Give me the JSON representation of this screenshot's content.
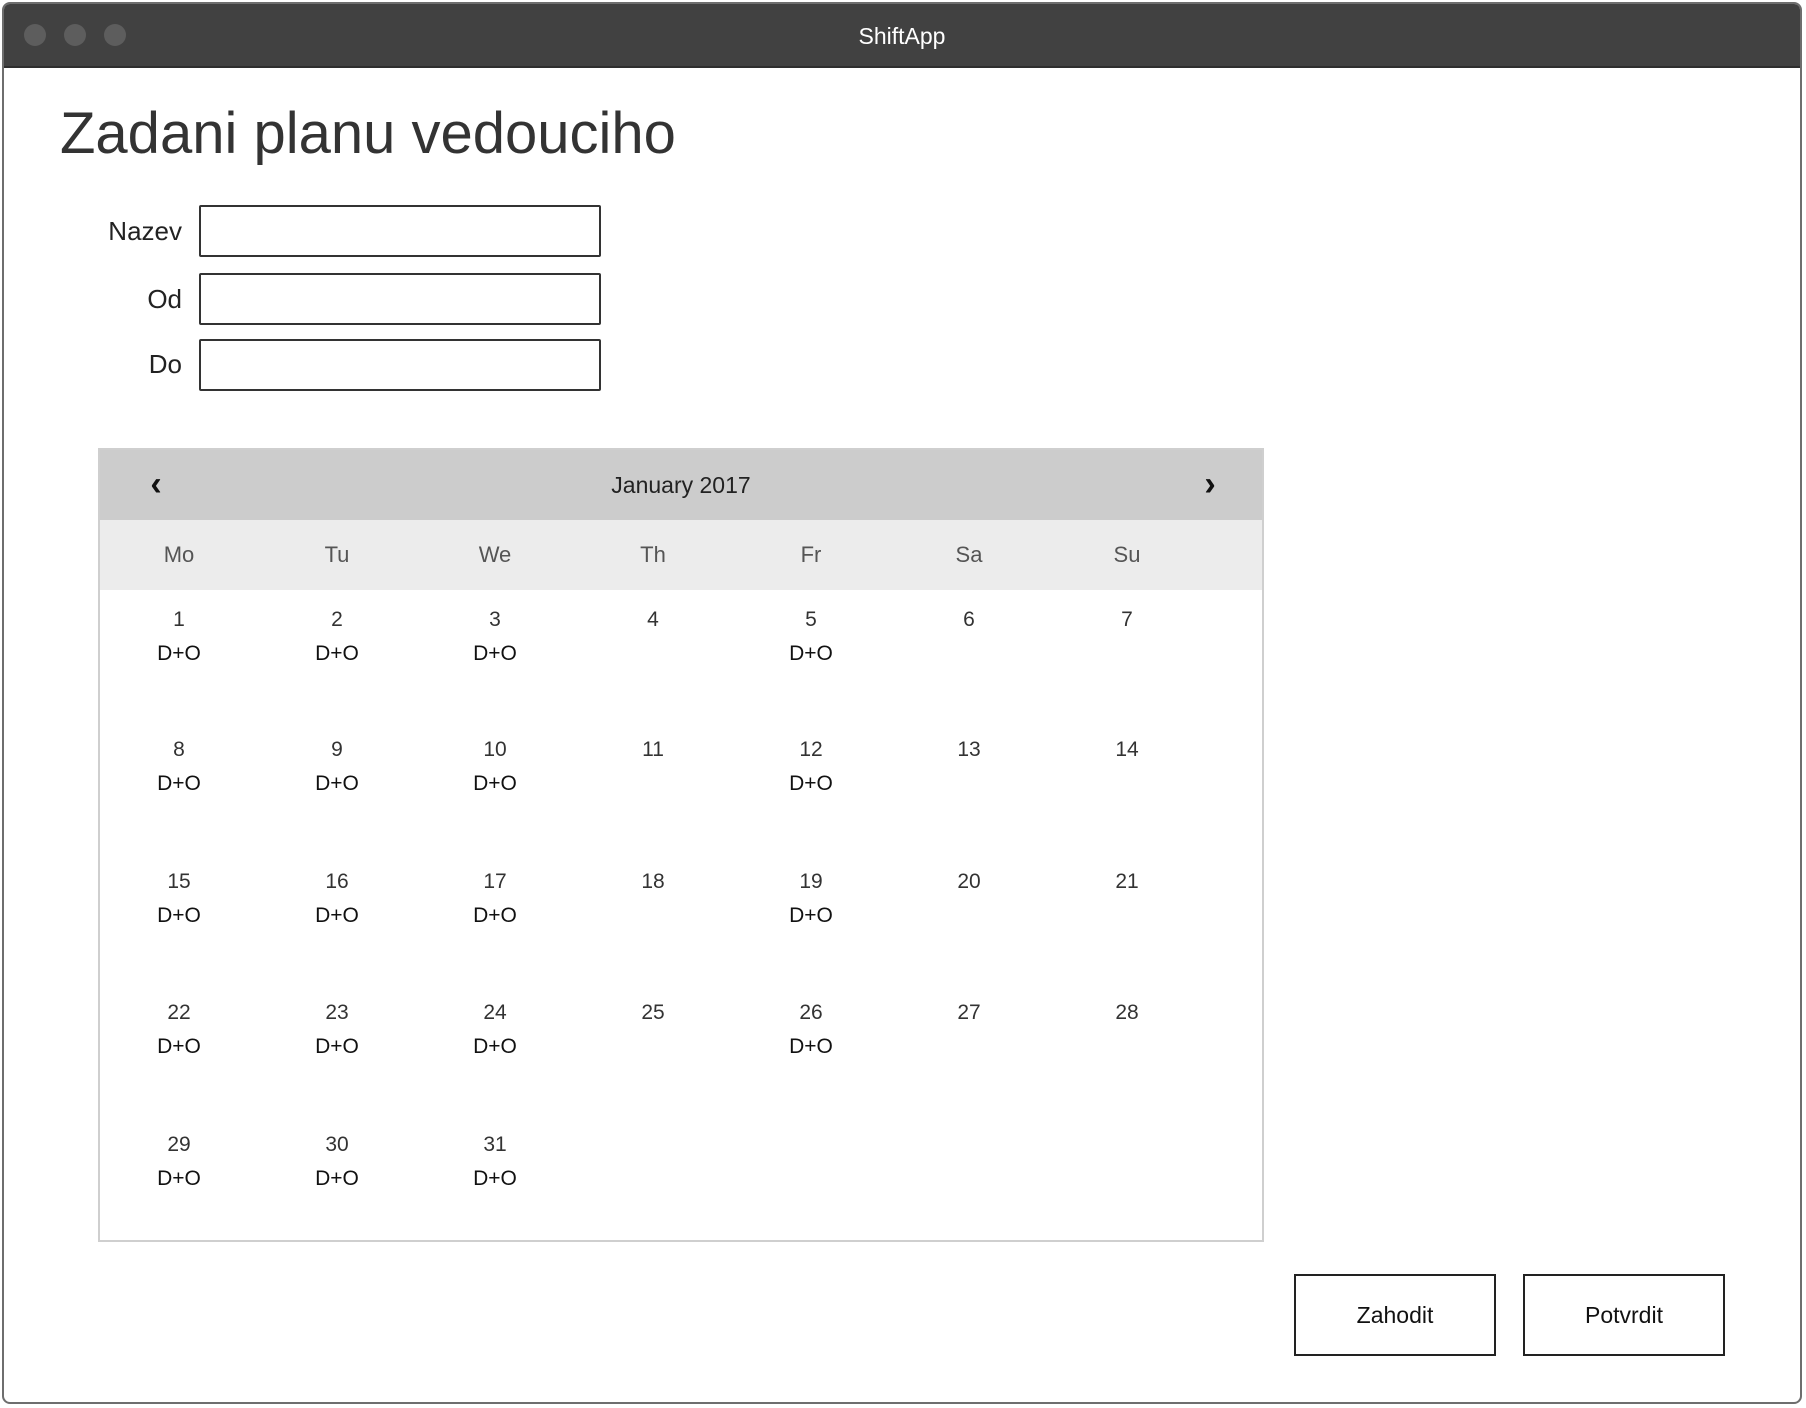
{
  "window": {
    "title": "ShiftApp"
  },
  "page": {
    "title": "Zadani planu vedouciho"
  },
  "form": {
    "fields": [
      {
        "label": "Nazev",
        "value": "",
        "placeholder": ""
      },
      {
        "label": "Od",
        "value": "",
        "placeholder": ""
      },
      {
        "label": "Do",
        "value": "",
        "placeholder": ""
      }
    ]
  },
  "calendar": {
    "month_label": "January 2017",
    "prev_icon": "‹",
    "next_icon": "›",
    "weekdays": [
      "Mo",
      "Tu",
      "We",
      "Th",
      "Fr",
      "Sa",
      "Su"
    ],
    "days": [
      {
        "day": "1",
        "shift": "D+O"
      },
      {
        "day": "2",
        "shift": "D+O"
      },
      {
        "day": "3",
        "shift": "D+O"
      },
      {
        "day": "4",
        "shift": ""
      },
      {
        "day": "5",
        "shift": "D+O"
      },
      {
        "day": "6",
        "shift": ""
      },
      {
        "day": "7",
        "shift": ""
      },
      {
        "day": "8",
        "shift": "D+O"
      },
      {
        "day": "9",
        "shift": "D+O"
      },
      {
        "day": "10",
        "shift": "D+O"
      },
      {
        "day": "11",
        "shift": ""
      },
      {
        "day": "12",
        "shift": "D+O"
      },
      {
        "day": "13",
        "shift": ""
      },
      {
        "day": "14",
        "shift": ""
      },
      {
        "day": "15",
        "shift": "D+O"
      },
      {
        "day": "16",
        "shift": "D+O"
      },
      {
        "day": "17",
        "shift": "D+O"
      },
      {
        "day": "18",
        "shift": ""
      },
      {
        "day": "19",
        "shift": "D+O"
      },
      {
        "day": "20",
        "shift": ""
      },
      {
        "day": "21",
        "shift": ""
      },
      {
        "day": "22",
        "shift": "D+O"
      },
      {
        "day": "23",
        "shift": "D+O"
      },
      {
        "day": "24",
        "shift": "D+O"
      },
      {
        "day": "25",
        "shift": ""
      },
      {
        "day": "26",
        "shift": "D+O"
      },
      {
        "day": "27",
        "shift": ""
      },
      {
        "day": "28",
        "shift": ""
      },
      {
        "day": "29",
        "shift": "D+O"
      },
      {
        "day": "30",
        "shift": "D+O"
      },
      {
        "day": "31",
        "shift": "D+O"
      }
    ]
  },
  "actions": {
    "discard_label": "Zahodit",
    "confirm_label": "Potvrdit"
  }
}
